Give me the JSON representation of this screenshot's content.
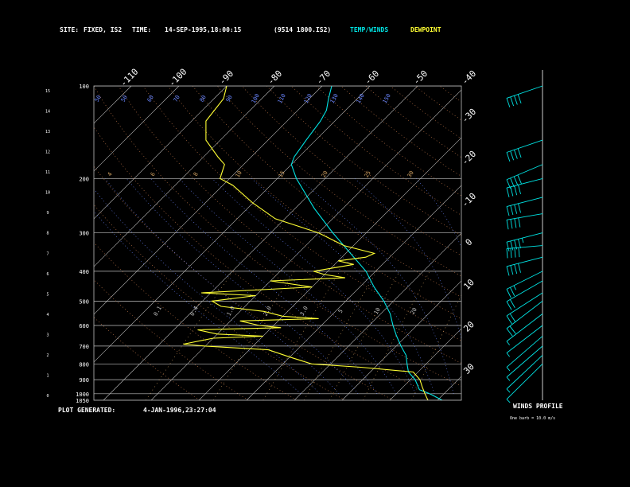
{
  "header": {
    "site_label": "SITE:",
    "site_value": "FIXED, IS2",
    "time_label": "TIME:",
    "time_value": "14-SEP-1995,18:00:15",
    "file_id": "(9514 1800.IS2)",
    "legend_temp": "TEMP/WINDS",
    "legend_dew": "DEWPOINT"
  },
  "footer": {
    "plot_generated_label": "PLOT GENERATED:",
    "plot_generated_value": "4-JAN-1996,23:27:04",
    "winds_profile_label": "WINDS PROFILE",
    "barb_note": "One barb = 10.0 m/s"
  },
  "colors": {
    "background": "#000000",
    "text": "#ffffff",
    "temperature": "#00e5e5",
    "dewpoint": "#ffff33",
    "isobar": "#bfbfbf",
    "isotherm": "#bfbfbf",
    "dry_adiabat": "#d08050",
    "moist_adiabat": "#6a86ff",
    "mixing_ratio": "#d0a060"
  },
  "chart_data": {
    "type": "line",
    "subtype": "skew-T log-P thermodynamic diagram",
    "pressure_levels_hpa": [
      100,
      200,
      300,
      400,
      500,
      600,
      700,
      800,
      900,
      1000,
      1050
    ],
    "height_ticks_km": [
      "15",
      "14",
      "13",
      "12",
      "11",
      "10",
      "9",
      "8",
      "7",
      "6",
      "5",
      "4",
      "3",
      "2",
      "1",
      "0"
    ],
    "top_temp_ticks_c": [
      "-110",
      "-100",
      "-90",
      "-80",
      "-70",
      "-60",
      "-50",
      "-40"
    ],
    "right_temp_ticks_c": [
      "-30",
      "-20",
      "-10",
      "0",
      "10",
      "20",
      "30"
    ],
    "dry_adiabat_labels": [
      "50",
      "50",
      "60",
      "70",
      "80",
      "90",
      "100",
      "110",
      "120",
      "130",
      "140",
      "150"
    ],
    "moist_adiabat_labels": [
      "4",
      "6",
      "8",
      "10",
      "15",
      "20",
      "25",
      "30"
    ],
    "mixing_ratio_labels": [
      "0.1",
      "0.4",
      "1.0",
      "2.0",
      "3.0",
      "5",
      "10",
      "20"
    ],
    "ylim_hpa": [
      1050,
      100
    ],
    "temperature_series": {
      "name": "TEMP/WINDS",
      "points": [
        [
          1050,
          21
        ],
        [
          1000,
          17
        ],
        [
          970,
          14
        ],
        [
          900,
          11
        ],
        [
          850,
          8
        ],
        [
          800,
          6
        ],
        [
          750,
          4
        ],
        [
          700,
          1
        ],
        [
          650,
          -2
        ],
        [
          600,
          -5
        ],
        [
          550,
          -8
        ],
        [
          500,
          -12
        ],
        [
          450,
          -17
        ],
        [
          400,
          -22
        ],
        [
          350,
          -29
        ],
        [
          300,
          -37
        ],
        [
          250,
          -46
        ],
        [
          200,
          -56
        ],
        [
          180,
          -60
        ],
        [
          170,
          -61
        ],
        [
          150,
          -62
        ],
        [
          130,
          -63
        ],
        [
          120,
          -64
        ],
        [
          110,
          -66
        ],
        [
          100,
          -68
        ]
      ]
    },
    "dewpoint_series": {
      "name": "DEWPOINT",
      "points": [
        [
          1050,
          18
        ],
        [
          1000,
          16
        ],
        [
          950,
          14
        ],
        [
          900,
          12
        ],
        [
          850,
          9
        ],
        [
          820,
          -3
        ],
        [
          800,
          -14
        ],
        [
          760,
          -20
        ],
        [
          720,
          -26
        ],
        [
          700,
          -40
        ],
        [
          690,
          -45
        ],
        [
          660,
          -40
        ],
        [
          650,
          -30
        ],
        [
          640,
          -40
        ],
        [
          620,
          -45
        ],
        [
          610,
          -28
        ],
        [
          600,
          -33
        ],
        [
          580,
          -38
        ],
        [
          570,
          -22
        ],
        [
          560,
          -30
        ],
        [
          540,
          -35
        ],
        [
          520,
          -45
        ],
        [
          500,
          -48
        ],
        [
          480,
          -40
        ],
        [
          470,
          -52
        ],
        [
          450,
          -30
        ],
        [
          430,
          -40
        ],
        [
          420,
          -25
        ],
        [
          410,
          -30
        ],
        [
          400,
          -33
        ],
        [
          380,
          -26
        ],
        [
          370,
          -30
        ],
        [
          360,
          -25
        ],
        [
          350,
          -24
        ],
        [
          330,
          -32
        ],
        [
          300,
          -40
        ],
        [
          270,
          -52
        ],
        [
          240,
          -60
        ],
        [
          210,
          -68
        ],
        [
          200,
          -72
        ],
        [
          180,
          -74
        ],
        [
          170,
          -77
        ],
        [
          150,
          -83
        ],
        [
          130,
          -87
        ],
        [
          110,
          -88
        ],
        [
          100,
          -90
        ]
      ]
    },
    "wind_profile_barbs": [
      {
        "level": 100,
        "dir": 290,
        "spd": 22
      },
      {
        "level": 150,
        "dir": 290,
        "spd": 19
      },
      {
        "level": 180,
        "dir": 295,
        "spd": 22
      },
      {
        "level": 200,
        "dir": 285,
        "spd": 18
      },
      {
        "level": 230,
        "dir": 285,
        "spd": 22
      },
      {
        "level": 260,
        "dir": 280,
        "spd": 20
      },
      {
        "level": 300,
        "dir": 285,
        "spd": 23
      },
      {
        "level": 330,
        "dir": 275,
        "spd": 20
      },
      {
        "level": 360,
        "dir": 285,
        "spd": 18
      },
      {
        "level": 400,
        "dir": 300,
        "spd": 14
      },
      {
        "level": 430,
        "dir": 305,
        "spd": 12
      },
      {
        "level": 470,
        "dir": 310,
        "spd": 10
      },
      {
        "level": 500,
        "dir": 320,
        "spd": 8
      },
      {
        "level": 550,
        "dir": 320,
        "spd": 7
      },
      {
        "level": 600,
        "dir": 320,
        "spd": 6
      },
      {
        "level": 650,
        "dir": 330,
        "spd": 6
      },
      {
        "level": 700,
        "dir": 330,
        "spd": 5
      },
      {
        "level": 750,
        "dir": 340,
        "spd": 4
      },
      {
        "level": 800,
        "dir": 350,
        "spd": 3
      }
    ]
  }
}
